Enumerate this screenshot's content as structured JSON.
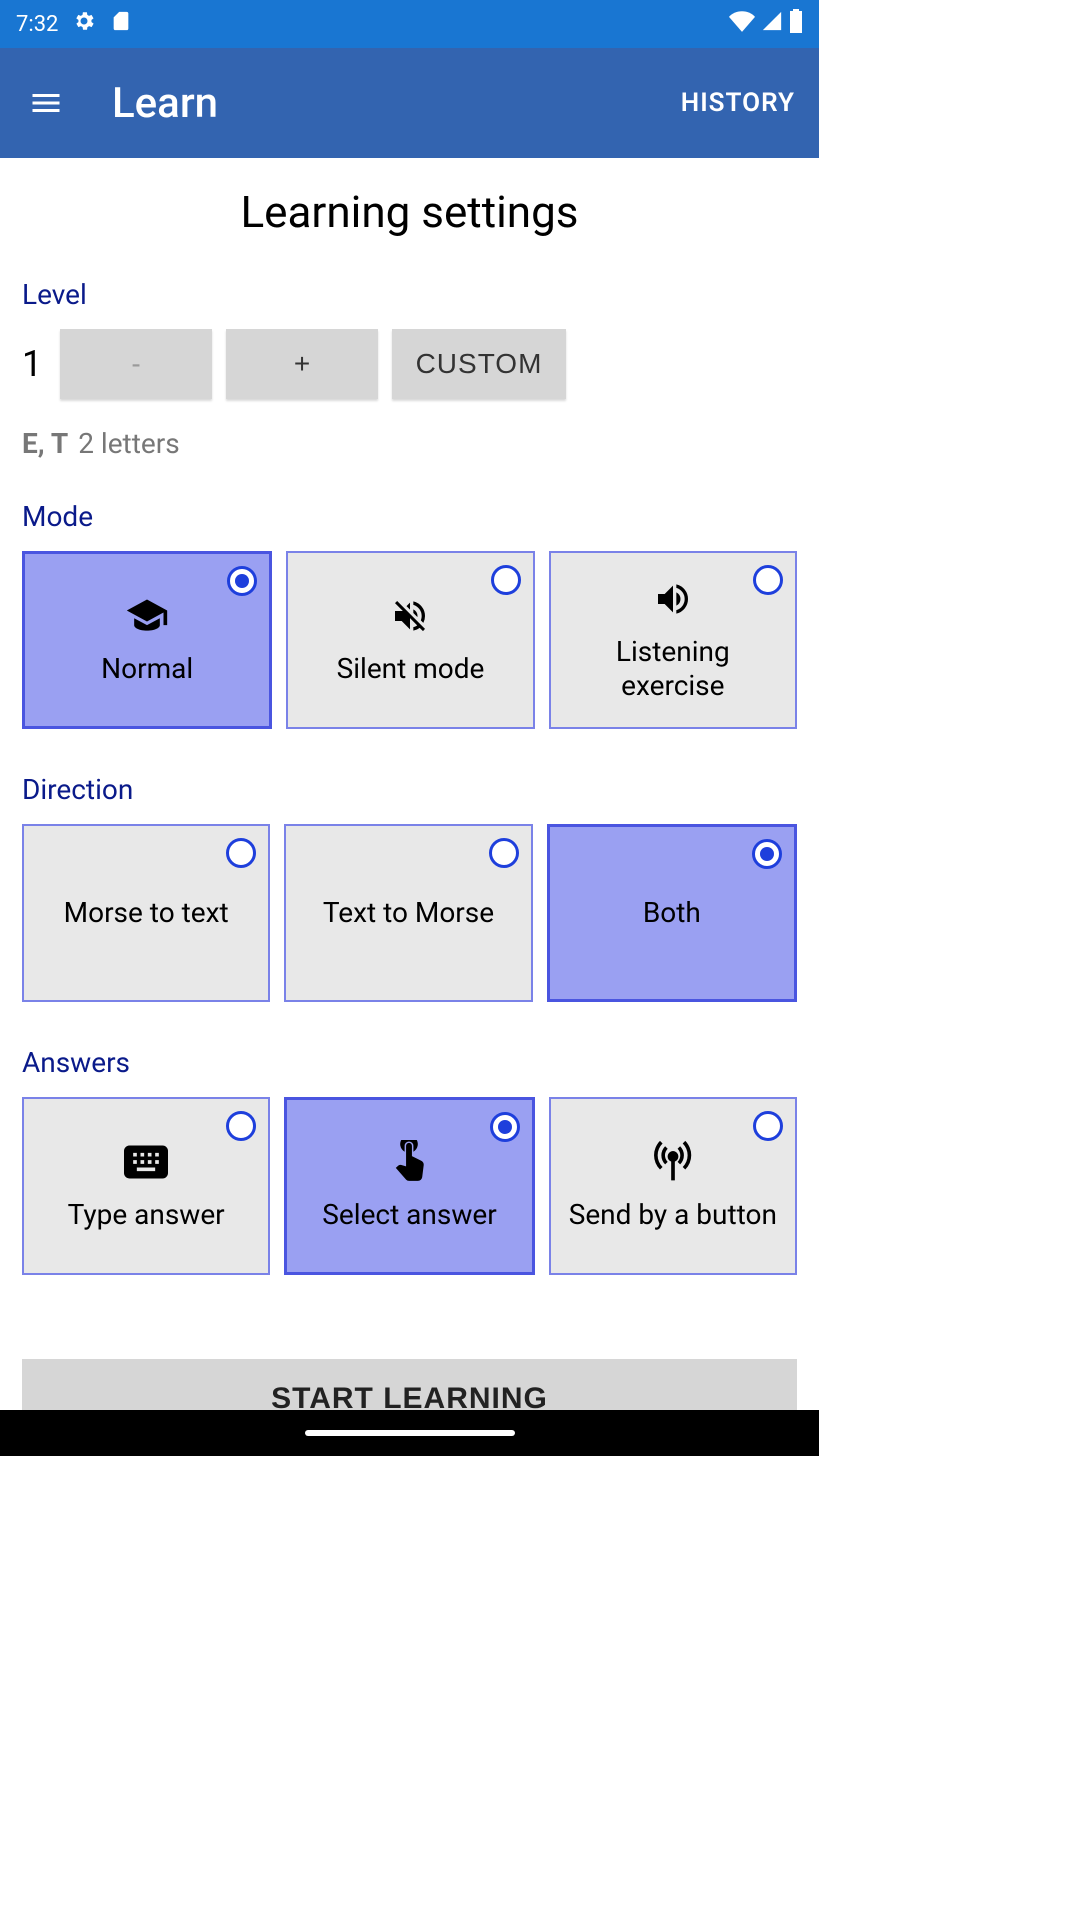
{
  "status": {
    "time": "7:32"
  },
  "appbar": {
    "title": "Learn",
    "history": "HISTORY"
  },
  "page_title": "Learning settings",
  "sections": {
    "level": "Level",
    "mode": "Mode",
    "direction": "Direction",
    "answers": "Answers"
  },
  "level": {
    "value": "1",
    "minus": "-",
    "plus": "+",
    "custom": "CUSTOM",
    "hint_chars": "E, T",
    "hint_count": "2 letters"
  },
  "mode": {
    "options": [
      {
        "label": "Normal",
        "selected": true,
        "icon": "graduation"
      },
      {
        "label": "Silent mode",
        "selected": false,
        "icon": "volume-off"
      },
      {
        "label": "Listening exercise",
        "selected": false,
        "icon": "volume-up"
      }
    ]
  },
  "direction": {
    "options": [
      {
        "label": "Morse to text",
        "selected": false
      },
      {
        "label": "Text to Morse",
        "selected": false
      },
      {
        "label": "Both",
        "selected": true
      }
    ]
  },
  "answers": {
    "options": [
      {
        "label": "Type answer",
        "selected": false,
        "icon": "keyboard"
      },
      {
        "label": "Select answer",
        "selected": true,
        "icon": "touch"
      },
      {
        "label": "Send by a button",
        "selected": false,
        "icon": "antenna"
      }
    ]
  },
  "start": "START LEARNING"
}
